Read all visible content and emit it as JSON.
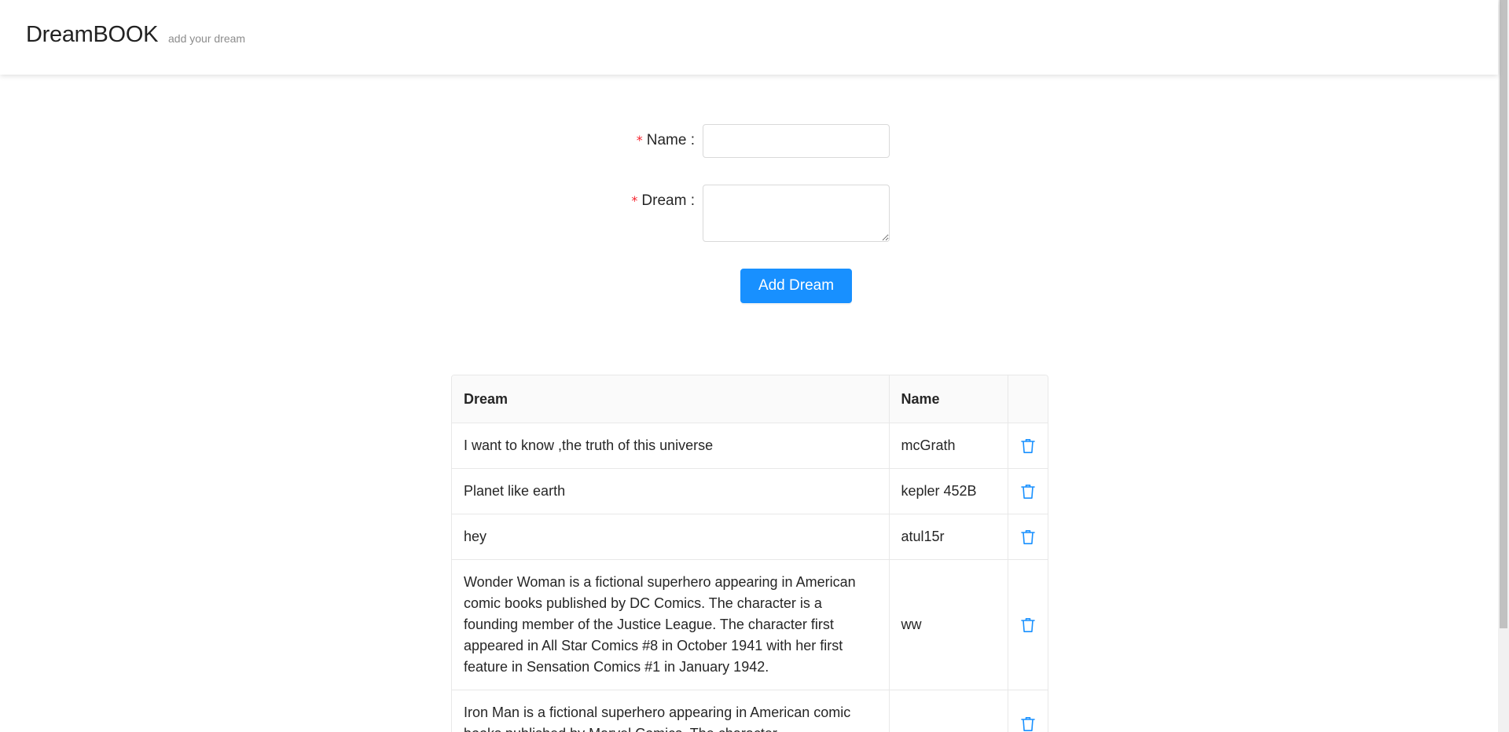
{
  "header": {
    "brand": "DreamBOOK",
    "tagline": "add your dream"
  },
  "form": {
    "required_mark": "*",
    "name_label": "Name :",
    "name_value": "",
    "dream_label": "Dream :",
    "dream_value": "",
    "submit_label": "Add Dream"
  },
  "table": {
    "columns": [
      "Dream",
      "Name",
      ""
    ],
    "rows": [
      {
        "dream": "I want to know ,the truth of this universe",
        "name": "mcGrath",
        "action_icon": "trash-icon"
      },
      {
        "dream": "Planet like earth",
        "name": "kepler 452B",
        "action_icon": "trash-icon"
      },
      {
        "dream": "hey",
        "name": "atul15r",
        "action_icon": "trash-icon"
      },
      {
        "dream": "Wonder Woman is a fictional superhero appearing in American comic books published by DC Comics. The character is a founding member of the Justice League. The character first appeared in All Star Comics #8 in October 1941 with her first feature in Sensation Comics #1 in January 1942.",
        "name": "ww",
        "action_icon": "trash-icon"
      },
      {
        "dream": "Iron Man is a fictional superhero appearing in American comic books published by Marvel Comics. The character",
        "name": "",
        "action_icon": "trash-icon"
      }
    ]
  },
  "colors": {
    "primary": "#1890ff",
    "required": "#f5222d",
    "header_bg": "#fafafa",
    "border": "#e8e8e8"
  }
}
